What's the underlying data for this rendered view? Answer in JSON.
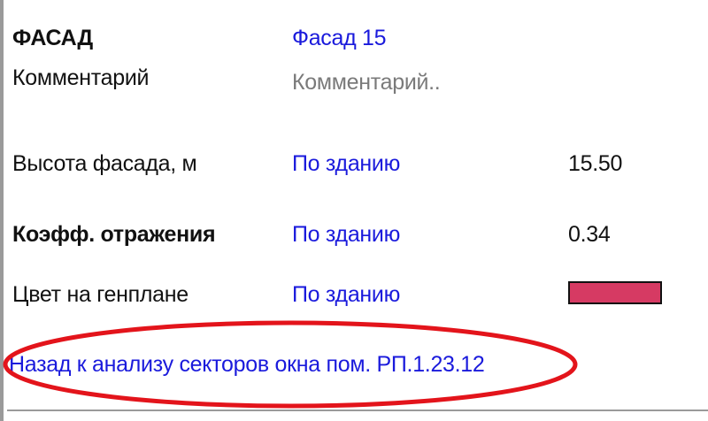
{
  "facade": {
    "title_label": "ФАСАД",
    "title_value": "Фасад 15",
    "comment_label": "Комментарий",
    "comment_placeholder": "Комментарий.."
  },
  "rows": [
    {
      "label": "Высота фасада, м",
      "source": "По зданию",
      "value": "15.50"
    },
    {
      "label": "Коэфф. отражения",
      "source": "По зданию",
      "value": "0.34"
    },
    {
      "label": "Цвет на генплане",
      "source": "По зданию",
      "color": "#d63a63"
    }
  ],
  "back_link": "Назад к анализу секторов окна пом. РП.1.23.12",
  "colors": {
    "link": "#1a1adc",
    "placeholder": "#7a7a7a",
    "annotation": "#e3141b"
  }
}
